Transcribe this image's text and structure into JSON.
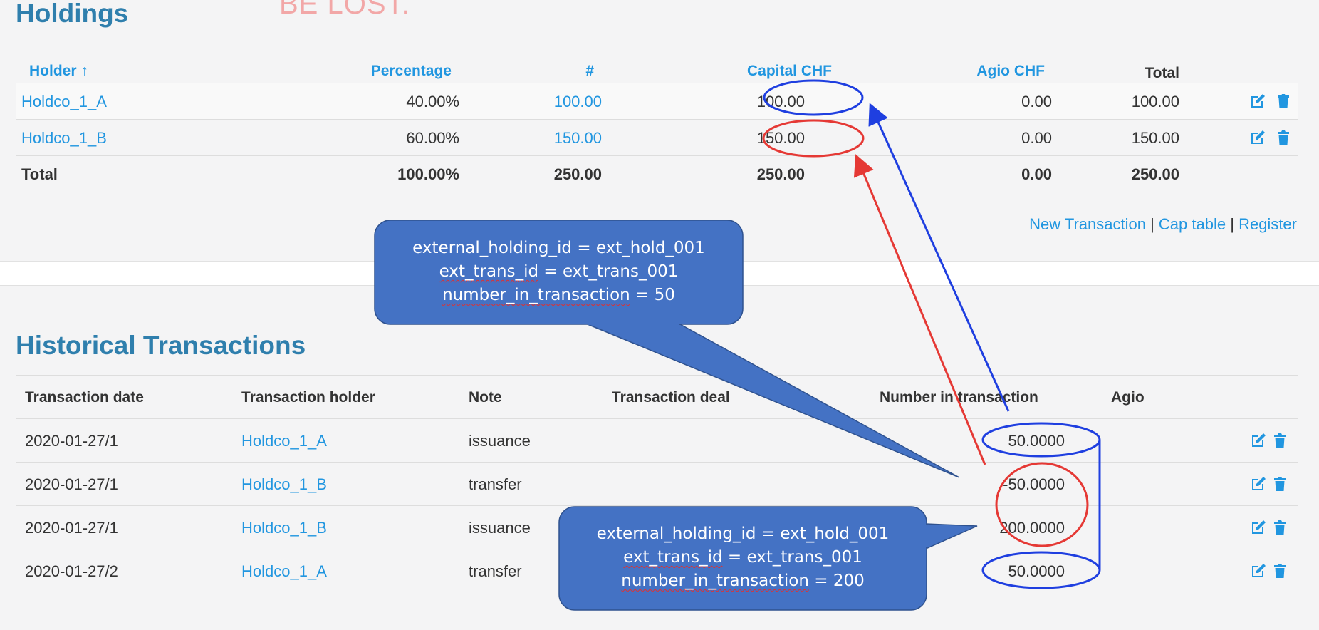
{
  "holdings": {
    "title": "Holdings",
    "ghost_text": "BE LOST.",
    "columns": {
      "holder": "Holder ↑",
      "percentage": "Percentage",
      "count": "#",
      "capital": "Capital CHF",
      "agio": "Agio CHF",
      "total": "Total"
    },
    "rows": [
      {
        "holder": "Holdco_1_A",
        "percentage": "40.00%",
        "count": "100.00",
        "capital": "100.00",
        "agio": "0.00",
        "total": "100.00"
      },
      {
        "holder": "Holdco_1_B",
        "percentage": "60.00%",
        "count": "150.00",
        "capital": "150.00",
        "agio": "0.00",
        "total": "150.00"
      }
    ],
    "totals": {
      "label": "Total",
      "percentage": "100.00%",
      "count": "250.00",
      "capital": "250.00",
      "agio": "0.00",
      "total": "250.00"
    },
    "links": {
      "new_transaction": "New Transaction",
      "sep1": "|",
      "cap_table": "Cap table",
      "sep2": "|",
      "register": "Register"
    }
  },
  "historical": {
    "title": "Historical Transactions",
    "columns": {
      "date": "Transaction date",
      "holder": "Transaction holder",
      "note": "Note",
      "deal": "Transaction deal",
      "number": "Number in transaction",
      "agio": "Agio"
    },
    "rows": [
      {
        "date": "2020-01-27/1",
        "holder": "Holdco_1_A",
        "note": "issuance",
        "deal": "",
        "number": "50.0000",
        "agio": ""
      },
      {
        "date": "2020-01-27/1",
        "holder": "Holdco_1_B",
        "note": "transfer",
        "deal": "",
        "number": "-50.0000",
        "agio": ""
      },
      {
        "date": "2020-01-27/1",
        "holder": "Holdco_1_B",
        "note": "issuance",
        "deal": "",
        "number": "200.0000",
        "agio": ""
      },
      {
        "date": "2020-01-27/2",
        "holder": "Holdco_1_A",
        "note": "transfer",
        "deal": "",
        "number": "50.0000",
        "agio": ""
      }
    ]
  },
  "callouts": {
    "top": {
      "line1": "external_holding_id = ext_hold_001",
      "line2a": "ext_trans_id",
      "line2b": " = ext_trans_001",
      "line3a": "number_in_transaction",
      "line3b": " = 50"
    },
    "bottom": {
      "line1": "external_holding_id = ext_hold_001",
      "line2a": "ext_trans_id",
      "line2b": " = ext_trans_001",
      "line3a": "number_in_transaction",
      "line3b": " = 200"
    }
  },
  "icons": {
    "edit": "edit-icon",
    "delete": "trash-icon"
  },
  "colors": {
    "link": "#2196e0",
    "title": "#2f7fad",
    "callout": "#4472c4",
    "annot_blue": "#1f3fe0",
    "annot_red": "#e53935"
  }
}
